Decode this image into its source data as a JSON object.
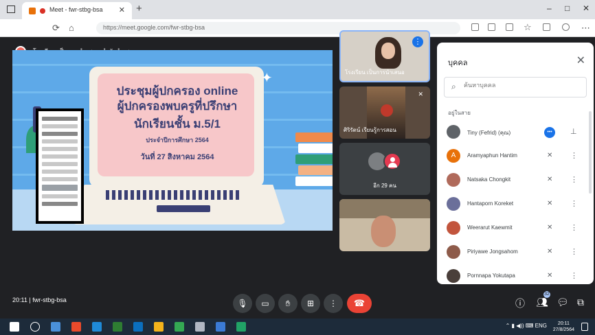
{
  "browser": {
    "tab_title": "Meet - fwr-stbg-bsa",
    "url": "https://meet.google.com/fwr-stbg-bsa",
    "window_controls": [
      "–",
      "□",
      "✕"
    ]
  },
  "presenter": {
    "text": "โรงเรียน เป็นการนำเสนอ กำลังนำเสนอ"
  },
  "slide": {
    "line1": "ประชุมผู้ปกครอง online",
    "line2": "ผู้ปกครองพบครูที่ปรึกษา",
    "line3": "นักเรียนชั้น ม.5/1",
    "line4": "ประจำปีการศึกษา 2564",
    "line5": "วันที่ 27 สิงหาคม 2564"
  },
  "tiles": [
    {
      "name": "โรงเรียน เป็นการนำเสนอ"
    },
    {
      "name": "ศิริรัตน์ เรียนรู้การสอน"
    },
    {
      "name": "อีก 29 คน"
    },
    {
      "name": ""
    }
  ],
  "panel": {
    "title": "บุคคล",
    "search_placeholder": "ค้นหาบุคคล",
    "section": "อยู่ในสาย",
    "participants": [
      {
        "name": "Tiny (Fefrid) (คุณ)",
        "initial": "",
        "color": "#5f6368"
      },
      {
        "name": "Aramyaphun Hantim",
        "initial": "A",
        "color": "#e8710a"
      },
      {
        "name": "Natsaka Chongkit",
        "initial": "",
        "color": "#b06a5b"
      },
      {
        "name": "Hantaporn Koreket",
        "initial": "",
        "color": "#6b6f9a"
      },
      {
        "name": "Weerarut Kaewmit",
        "initial": "",
        "color": "#c2553d"
      },
      {
        "name": "Piriyawe Jongsahom",
        "initial": "",
        "color": "#8e5b4a"
      },
      {
        "name": "Pornnapa Yokutapa",
        "initial": "",
        "color": "#4a3f3a"
      }
    ]
  },
  "controls": {
    "time": "20:11",
    "meeting_code": "fwr-stbg-bsa",
    "participant_count": "32"
  },
  "taskbar": {
    "time": "20:11",
    "date": "27/8/2564"
  }
}
